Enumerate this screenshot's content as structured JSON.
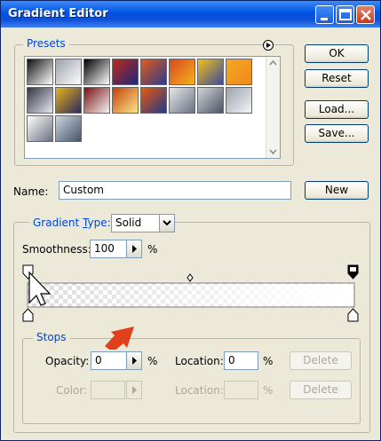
{
  "window": {
    "title": "Gradient Editor"
  },
  "presets": {
    "legend": "Presets",
    "swatches": [
      {
        "a": "#111111",
        "b": "#ffffff"
      },
      {
        "a": "#9aa0aa",
        "b": "#ffffff"
      },
      {
        "a": "#000000",
        "b": "#ffffff"
      },
      {
        "a": "#c0261b",
        "b": "#1a2a7a"
      },
      {
        "a": "#e25b1a",
        "b": "#2b3a8c"
      },
      {
        "a": "#d8481f",
        "b": "#f3b31a"
      },
      {
        "a": "#f1c21b",
        "b": "#3b4a9a"
      },
      {
        "a": "#f5a623",
        "b": "#f08a1c"
      },
      {
        "a": "#333344",
        "b": "#e8e8f0"
      },
      {
        "a": "#e8b318",
        "b": "#2a2a60"
      },
      {
        "a": "#7a1010",
        "b": "#f3f3f3"
      },
      {
        "a": "#c2410c",
        "b": "#fde68a"
      },
      {
        "a": "#ea580c",
        "b": "#1e3a8a"
      },
      {
        "a": "#e5e7eb",
        "b": "#6b7280"
      },
      {
        "a": "#d1d5db",
        "b": "#4b5563"
      },
      {
        "a": "#9ca3af",
        "b": "#f3f4f6"
      },
      {
        "a": "#ffffff",
        "b": "#6b7280"
      },
      {
        "a": "#cbd5e1",
        "b": "#475569"
      }
    ]
  },
  "buttons": {
    "ok": "OK",
    "reset": "Reset",
    "load": "Load...",
    "save": "Save...",
    "new": "New",
    "delete_opacity": "Delete",
    "delete_color": "Delete"
  },
  "name_field": {
    "label": "Name:",
    "value": "Custom"
  },
  "gradient": {
    "legend_prefix": "Gradient ",
    "legend_type_key": "T",
    "legend_suffix": "ype:",
    "type_value": "Solid",
    "smoothness_label": "Smoothness:",
    "smoothness_value": "100",
    "pct": "%"
  },
  "stops": {
    "legend": "Stops",
    "opacity_label": "Opacity:",
    "opacity_value": "0",
    "opacity_pct": "%",
    "location_label": "Location:",
    "location_value": "0",
    "location_pct": "%",
    "color_label": "Color:",
    "color_location_label": "Location:",
    "color_location_pct": "%"
  }
}
